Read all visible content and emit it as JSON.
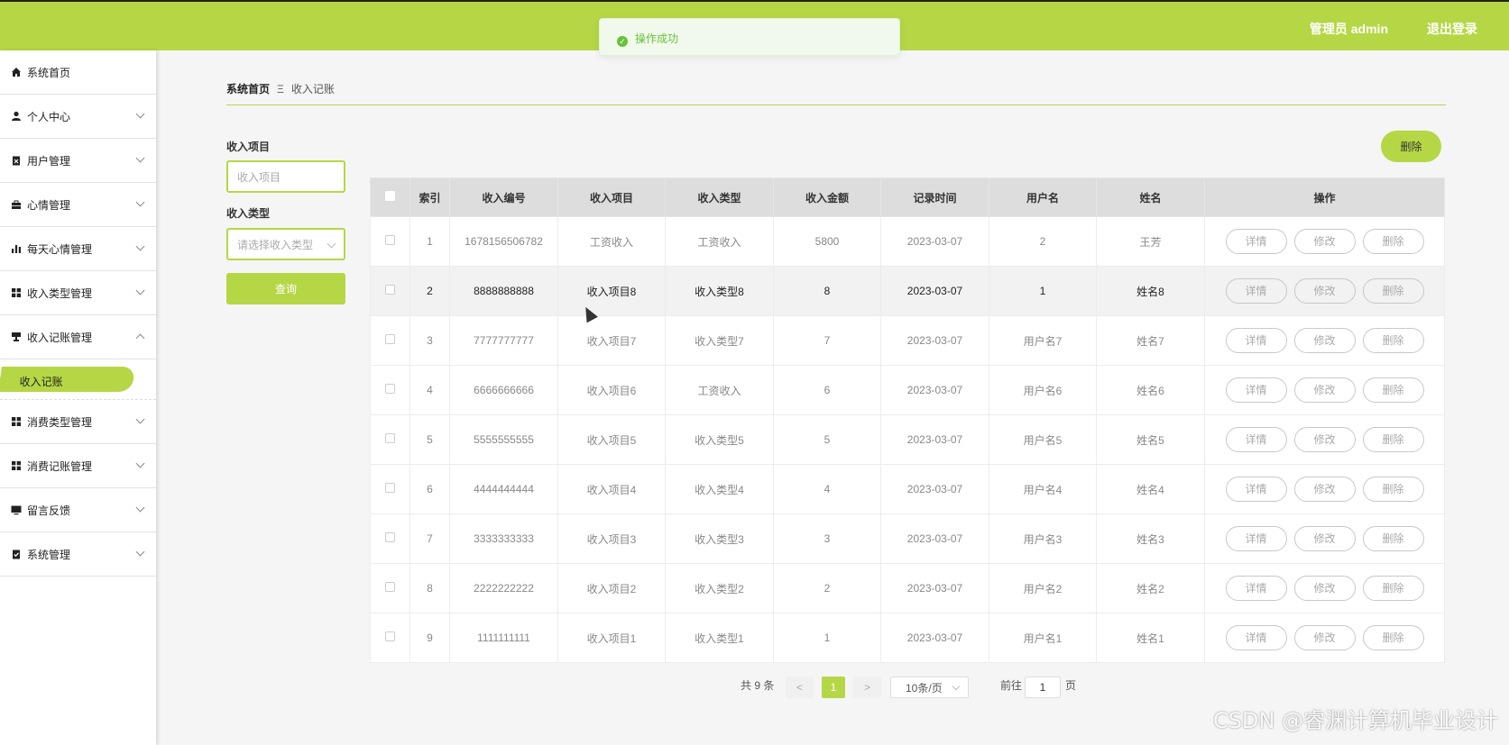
{
  "header": {
    "user_label": "管理员 admin",
    "logout_label": "退出登录"
  },
  "toast": {
    "message": "操作成功",
    "color": "#67c23a"
  },
  "theme": {
    "accent": "#b5d745"
  },
  "sidebar": {
    "items": [
      {
        "label": "系统首页",
        "icon": "home-icon"
      },
      {
        "label": "个人中心",
        "icon": "user-icon"
      },
      {
        "label": "用户管理",
        "icon": "clipboard-x-icon"
      },
      {
        "label": "心情管理",
        "icon": "briefcase-icon"
      },
      {
        "label": "每天心情管理",
        "icon": "bar-chart-icon"
      },
      {
        "label": "收入类型管理",
        "icon": "grid-icon"
      },
      {
        "label": "收入记账管理",
        "icon": "stamp-icon"
      }
    ],
    "active_sub": "收入记账",
    "items_after": [
      {
        "label": "消费类型管理",
        "icon": "grid-icon"
      },
      {
        "label": "消费记账管理",
        "icon": "grid-icon"
      },
      {
        "label": "留言反馈",
        "icon": "monitor-icon"
      },
      {
        "label": "系统管理",
        "icon": "clipboard-check-icon"
      }
    ]
  },
  "breadcrumb": {
    "home": "系统首页",
    "separator": "Ξ",
    "current": "收入记账"
  },
  "filter": {
    "item_label": "收入项目",
    "item_placeholder": "收入项目",
    "type_label": "收入类型",
    "type_placeholder": "请选择收入类型",
    "query_label": "查询"
  },
  "delete_label": "删除",
  "table": {
    "headers": [
      "索引",
      "收入编号",
      "收入项目",
      "收入类型",
      "收入金额",
      "记录时间",
      "用户名",
      "姓名",
      "操作"
    ],
    "actions": [
      "详情",
      "修改",
      "删除"
    ],
    "rows": [
      [
        "1",
        "1678156506782",
        "工资收入",
        "工资收入",
        "5800",
        "2023-03-07",
        "2",
        "王芳"
      ],
      [
        "2",
        "8888888888",
        "收入项目8",
        "收入类型8",
        "8",
        "2023-03-07",
        "1",
        "姓名8"
      ],
      [
        "3",
        "7777777777",
        "收入项目7",
        "收入类型7",
        "7",
        "2023-03-07",
        "用户名7",
        "姓名7"
      ],
      [
        "4",
        "6666666666",
        "收入项目6",
        "工资收入",
        "6",
        "2023-03-07",
        "用户名6",
        "姓名6"
      ],
      [
        "5",
        "5555555555",
        "收入项目5",
        "收入类型5",
        "5",
        "2023-03-07",
        "用户名5",
        "姓名5"
      ],
      [
        "6",
        "4444444444",
        "收入项目4",
        "收入类型4",
        "4",
        "2023-03-07",
        "用户名4",
        "姓名4"
      ],
      [
        "7",
        "3333333333",
        "收入项目3",
        "收入类型3",
        "3",
        "2023-03-07",
        "用户名3",
        "姓名3"
      ],
      [
        "8",
        "2222222222",
        "收入项目2",
        "收入类型2",
        "2",
        "2023-03-07",
        "用户名2",
        "姓名2"
      ],
      [
        "9",
        "1111111111",
        "收入项目1",
        "收入类型1",
        "1",
        "2023-03-07",
        "用户名1",
        "姓名1"
      ]
    ]
  },
  "pagination": {
    "total": "共 9 条",
    "prev": "<",
    "page": "1",
    "next": ">",
    "page_size": "10条/页",
    "goto_label": "前往",
    "goto_value": "1",
    "goto_suffix": "页"
  },
  "watermark": "CSDN @睿渊计算机毕业设计"
}
